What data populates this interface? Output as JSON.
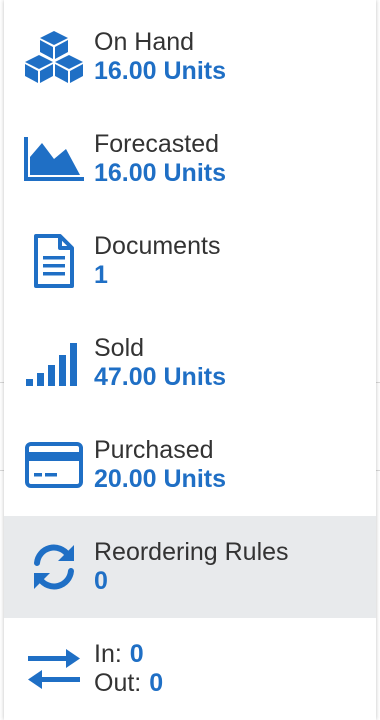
{
  "stats": {
    "on_hand": {
      "label": "On Hand",
      "value": "16.00 Units"
    },
    "forecasted": {
      "label": "Forecasted",
      "value": "16.00 Units"
    },
    "documents": {
      "label": "Documents",
      "value": "1"
    },
    "sold": {
      "label": "Sold",
      "value": "47.00 Units"
    },
    "purchased": {
      "label": "Purchased",
      "value": "20.00 Units"
    },
    "reordering_rules": {
      "label": "Reordering Rules",
      "value": "0"
    },
    "in_out": {
      "in_label": "In:",
      "in_value": "0",
      "out_label": "Out:",
      "out_value": "0"
    }
  },
  "colors": {
    "accent": "#1f6fc5",
    "label": "#333333",
    "active_bg": "#e8eaec"
  },
  "icons": {
    "on_hand": "cubes-icon",
    "forecasted": "area-chart-icon",
    "documents": "file-text-icon",
    "sold": "signal-bars-icon",
    "purchased": "credit-card-icon",
    "reordering_rules": "refresh-icon",
    "in_out": "exchange-icon"
  }
}
